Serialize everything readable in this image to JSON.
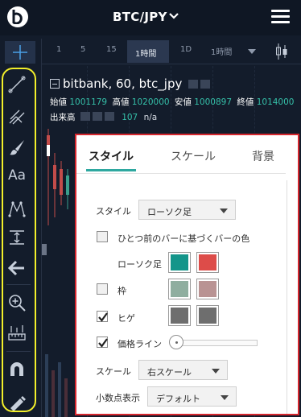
{
  "header": {
    "pair": "BTC/JPY"
  },
  "timeframes": [
    "1",
    "5",
    "15",
    "1時間",
    "1D",
    "1時間"
  ],
  "chart": {
    "title": "bitbank, 60, btc_jpy",
    "open_label": "始値",
    "open": "1001179",
    "high_label": "高値",
    "high": "1020000",
    "low_label": "安値",
    "low": "1000897",
    "close_label": "終値",
    "close": "1014000",
    "volume_label": "出来高",
    "volume": "107",
    "volume_extra": "n/a"
  },
  "dialog": {
    "tabs": [
      "スタイル",
      "スケール",
      "背景"
    ],
    "style_label": "スタイル",
    "style_value": "ローソク足",
    "prev_bar_label": "ひとつ前のバーに基づくバーの色",
    "candle_label": "ローソク足",
    "border_label": "枠",
    "wick_label": "ヒゲ",
    "price_line_label": "価格ライン",
    "scale_label": "スケール",
    "scale_value": "右スケール",
    "decimal_label": "小数点表示",
    "decimal_value": "デフォルト",
    "colors": {
      "candle_up": "#13958a",
      "candle_down": "#dd4c49",
      "border_up": "#8fae9f",
      "border_down": "#b99393",
      "wick_up": "#6e6e6e",
      "wick_down": "#6e6e6e"
    },
    "checks": {
      "prev_bar": false,
      "border": false,
      "wick": true,
      "price_line": true
    }
  }
}
